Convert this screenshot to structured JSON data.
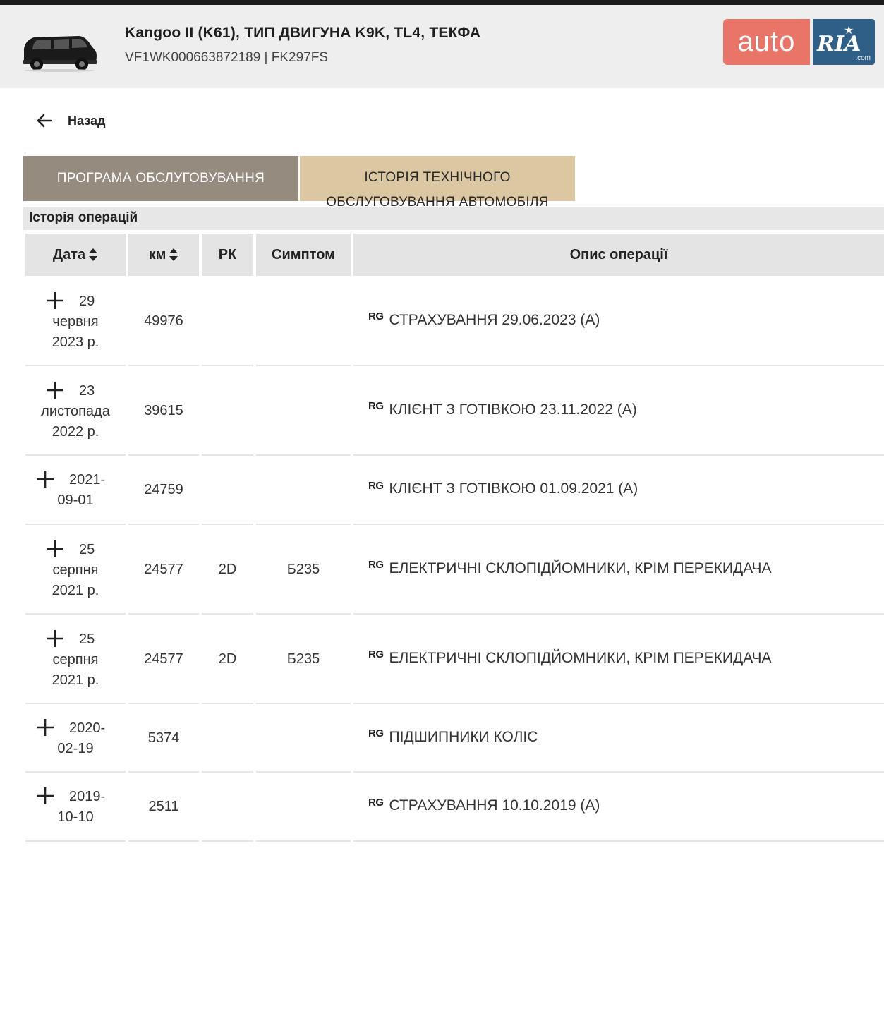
{
  "header": {
    "title": "Kangoo II (K61), ТИП ДВИГУНА K9K, TL4, ТЕКФА",
    "subtitle": "VF1WK000663872189 | FK297FS",
    "logo_auto": "auto",
    "logo_ria": "RIA",
    "logo_com": ".com"
  },
  "nav": {
    "back_label": "Назад"
  },
  "tabs": [
    {
      "label": "ПРОГРАМА ОБСЛУГОВУВАННЯ",
      "active": false
    },
    {
      "label_line1": "ІСТОРІЯ ТЕХНІЧНОГО",
      "label_line2": "ОБСЛУГОВУВАННЯ АВТОМОБІЛЯ",
      "active": true
    }
  ],
  "section_title": "Історія операцій",
  "table": {
    "columns": [
      "Дата",
      "км",
      "РК",
      "Симптом",
      "Опис операції"
    ],
    "rg_label": "RG",
    "rows": [
      {
        "date_l1": "29",
        "date_l2": "червня",
        "date_l3": "2023 р.",
        "km": "49976",
        "rk": "",
        "symptom": "",
        "desc": "СТРАХУВАННЯ 29.06.2023 (A)"
      },
      {
        "date_l1": "23",
        "date_l2": "листопада",
        "date_l3": "2022 р.",
        "km": "39615",
        "rk": "",
        "symptom": "",
        "desc": "КЛІЄНТ З ГОТІВКОЮ 23.11.2022 (A)"
      },
      {
        "date_l1": "2021-",
        "date_l2": "09-01",
        "date_l3": "",
        "km": "24759",
        "rk": "",
        "symptom": "",
        "desc": "КЛІЄНТ З ГОТІВКОЮ 01.09.2021 (A)"
      },
      {
        "date_l1": "25",
        "date_l2": "серпня",
        "date_l3": "2021 р.",
        "km": "24577",
        "rk": "2D",
        "symptom": "Б235",
        "desc": "ЕЛЕКТРИЧНІ СКЛОПІДЙОМНИКИ, КРІМ ПЕРЕКИДАЧА"
      },
      {
        "date_l1": "25",
        "date_l2": "серпня",
        "date_l3": "2021 р.",
        "km": "24577",
        "rk": "2D",
        "symptom": "Б235",
        "desc": "ЕЛЕКТРИЧНІ СКЛОПІДЙОМНИКИ, КРІМ ПЕРЕКИДАЧА"
      },
      {
        "date_l1": "2020-",
        "date_l2": "02-19",
        "date_l3": "",
        "km": "5374",
        "rk": "",
        "symptom": "",
        "desc": "ПІДШИПНИКИ КОЛІС"
      },
      {
        "date_l1": "2019-",
        "date_l2": "10-10",
        "date_l3": "",
        "km": "2511",
        "rk": "",
        "symptom": "",
        "desc": "СТРАХУВАННЯ 10.10.2019 (A)"
      }
    ]
  }
}
